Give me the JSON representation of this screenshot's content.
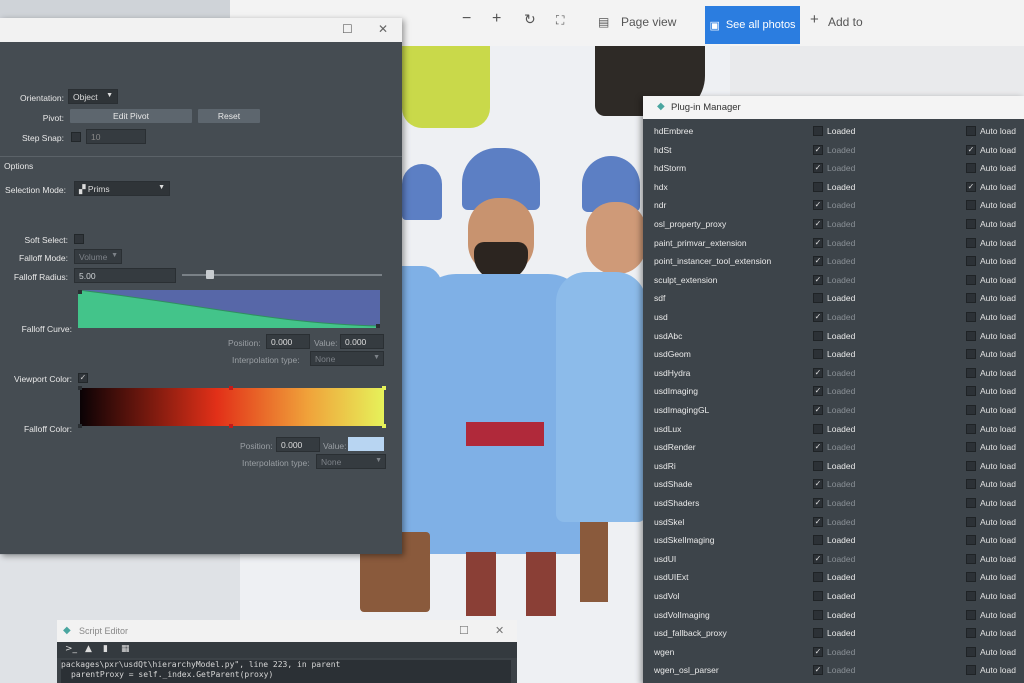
{
  "viewer": {
    "page_view_label": "Page view",
    "see_all_label": "See all photos",
    "add_to_label": "Add to"
  },
  "attr": {
    "orientation_label": "Orientation:",
    "orientation_value": "Object",
    "pivot_label": "Pivot:",
    "edit_pivot": "Edit Pivot",
    "reset": "Reset",
    "step_snap_label": "Step Snap:",
    "step_snap_value": "10",
    "options_header": "Options",
    "selection_mode_label": "Selection Mode:",
    "selection_mode_value": "Prims",
    "soft_select_label": "Soft Select:",
    "falloff_mode_label": "Falloff Mode:",
    "falloff_mode_value": "Volume",
    "falloff_radius_label": "Falloff Radius:",
    "falloff_radius_value": "5.00",
    "falloff_curve_label": "Falloff Curve:",
    "position_label": "Position:",
    "position_value": "0.000",
    "value_label": "Value:",
    "value_value": "0.000",
    "interp_label": "Interpolation type:",
    "interp_value": "None",
    "viewport_color_label": "Viewport Color:",
    "falloff_color_label": "Falloff Color:",
    "position2_label": "Position:",
    "position2_value": "0.000",
    "value2_label": "Value:",
    "interp2_label": "Interpolation type:",
    "interp2_value": "None"
  },
  "plugin_manager": {
    "title": "Plug-in Manager",
    "loaded_label": "Loaded",
    "auto_load_label": "Auto load",
    "plugins": [
      {
        "name": "hdEmbree",
        "loaded": false,
        "auto": false
      },
      {
        "name": "hdSt",
        "loaded": true,
        "auto": true
      },
      {
        "name": "hdStorm",
        "loaded": true,
        "auto": false
      },
      {
        "name": "hdx",
        "loaded": false,
        "auto": true
      },
      {
        "name": "ndr",
        "loaded": true,
        "auto": false
      },
      {
        "name": "osl_property_proxy",
        "loaded": true,
        "auto": false
      },
      {
        "name": "paint_primvar_extension",
        "loaded": true,
        "auto": false
      },
      {
        "name": "point_instancer_tool_extension",
        "loaded": true,
        "auto": false
      },
      {
        "name": "sculpt_extension",
        "loaded": true,
        "auto": false
      },
      {
        "name": "sdf",
        "loaded": false,
        "auto": false
      },
      {
        "name": "usd",
        "loaded": true,
        "auto": false
      },
      {
        "name": "usdAbc",
        "loaded": false,
        "auto": false
      },
      {
        "name": "usdGeom",
        "loaded": false,
        "auto": false
      },
      {
        "name": "usdHydra",
        "loaded": true,
        "auto": false
      },
      {
        "name": "usdImaging",
        "loaded": true,
        "auto": false
      },
      {
        "name": "usdImagingGL",
        "loaded": true,
        "auto": false
      },
      {
        "name": "usdLux",
        "loaded": false,
        "auto": false
      },
      {
        "name": "usdRender",
        "loaded": true,
        "auto": false
      },
      {
        "name": "usdRi",
        "loaded": false,
        "auto": false
      },
      {
        "name": "usdShade",
        "loaded": true,
        "auto": false
      },
      {
        "name": "usdShaders",
        "loaded": true,
        "auto": false
      },
      {
        "name": "usdSkel",
        "loaded": true,
        "auto": false
      },
      {
        "name": "usdSkelImaging",
        "loaded": false,
        "auto": false
      },
      {
        "name": "usdUI",
        "loaded": true,
        "auto": false
      },
      {
        "name": "usdUIExt",
        "loaded": false,
        "auto": false
      },
      {
        "name": "usdVol",
        "loaded": false,
        "auto": false
      },
      {
        "name": "usdVolImaging",
        "loaded": false,
        "auto": false
      },
      {
        "name": "usd_fallback_proxy",
        "loaded": false,
        "auto": false
      },
      {
        "name": "wgen",
        "loaded": true,
        "auto": false
      },
      {
        "name": "wgen_osl_parser",
        "loaded": true,
        "auto": false
      }
    ]
  },
  "script_editor": {
    "title": "Script Editor",
    "line1": "packages\\pxr\\usdQt\\hierarchyModel.py\", line 223, in parent",
    "line2": "parentProxy = self._index.GetParent(proxy)"
  },
  "colors": {
    "accent": "#2b7de0",
    "panel": "#454c52",
    "loaded_active": "#eaeaea",
    "loaded_inactive": "#8a9096"
  }
}
